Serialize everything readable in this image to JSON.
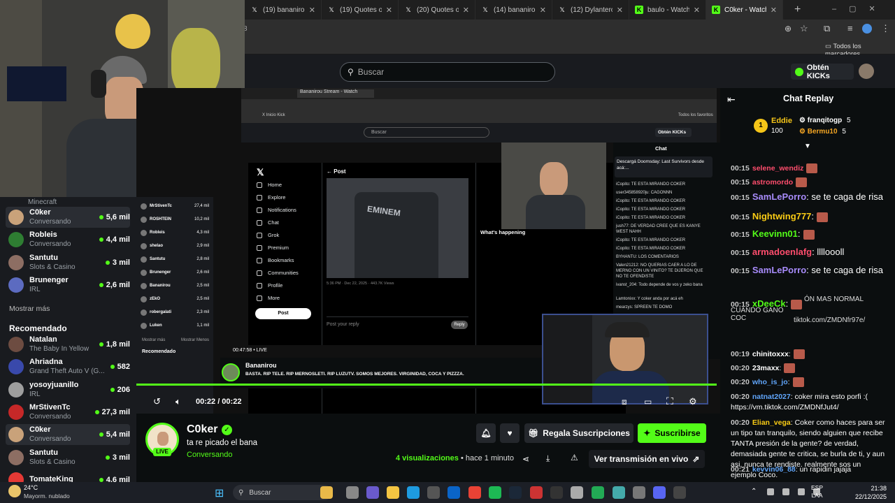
{
  "browser": {
    "tabs": [
      {
        "label": "(19) bananirou o",
        "icon": "x-logo-icon"
      },
      {
        "label": "(19) Quotes of th",
        "icon": "x-logo-icon"
      },
      {
        "label": "(20) Quotes of th",
        "icon": "x-logo-icon"
      },
      {
        "label": "(14) bananirou o",
        "icon": "x-logo-icon"
      },
      {
        "label": "(12) Dylantero o",
        "icon": "x-logo-icon"
      },
      {
        "label": "baulo - Watch cli",
        "icon": "kick-logo-icon"
      },
      {
        "label": "C0ker - Watch cli",
        "icon": "kick-logo-icon",
        "active": true
      }
    ],
    "address_fragment": "8",
    "bookmarks_label": "Todos los marcadores"
  },
  "header": {
    "search_placeholder": "Buscar",
    "get_kicks_label": "Obtén KICKs"
  },
  "sidebar": {
    "top_category": "Minecraft",
    "following": [
      {
        "name": "C0ker",
        "category": "Conversando",
        "viewers": "5,6 mil",
        "color": "#c9a27a",
        "selected": true
      },
      {
        "name": "Robleis",
        "category": "Conversando",
        "viewers": "4,4 mil",
        "color": "#2e7d32"
      },
      {
        "name": "Santutu",
        "category": "Slots & Casino",
        "viewers": "3 mil",
        "color": "#8d6e63"
      },
      {
        "name": "Brunenger",
        "category": "IRL",
        "viewers": "2,6 mil",
        "color": "#5c6bc0"
      }
    ],
    "show_more": "Mostrar más",
    "recommended_title": "Recomendado",
    "recommended": [
      {
        "name": "Natalan",
        "category": "The Baby In Yellow",
        "viewers": "1,8 mil",
        "color": "#6d4c41"
      },
      {
        "name": "Ahriadna",
        "category": "Grand Theft Auto V (G...",
        "viewers": "582",
        "color": "#3949ab"
      },
      {
        "name": "yosoyjuanillo",
        "category": "IRL",
        "viewers": "206",
        "color": "#9e9e9e"
      },
      {
        "name": "MrStivenTc",
        "category": "Conversando",
        "viewers": "27,3 mil",
        "color": "#c62828"
      },
      {
        "name": "C0ker",
        "category": "Conversando",
        "viewers": "5,4 mil",
        "color": "#c9a27a",
        "selected": true
      },
      {
        "name": "Santutu",
        "category": "Slots & Casino",
        "viewers": "3 mil",
        "color": "#8d6e63"
      },
      {
        "name": "TomateKing",
        "category": "",
        "viewers": "4,6 mil",
        "color": "#e53935"
      }
    ]
  },
  "player": {
    "time": "00:22 / 00:22"
  },
  "stream": {
    "channel": "C0ker",
    "title": "ta re picado el bana",
    "category": "Conversando",
    "live_badge": "LIVE",
    "gift_label": "Regala Suscripciones",
    "subscribe_label": "Suscribirse",
    "views": "4 visualizaciones",
    "ago": "• hace 1 minuto",
    "watch_live_label": "Ver transmisión en vivo"
  },
  "inner_stream": {
    "channel": "Bananirou",
    "title": "BASTA. RIP TELE. RIP MERNOSLETI. RIP LUZUTV. SOMOS MEJORES. VIRGINIDAD, COCA Y PIZZZA.",
    "time": "00:47:58",
    "live": "LIVE",
    "x_nav": [
      "Home",
      "Explore",
      "Notifications",
      "Chat",
      "Grok",
      "Premium",
      "Bookmarks",
      "Communities",
      "Profile",
      "More"
    ],
    "x_post_button": "Post",
    "x_header": "Post",
    "x_reply": "Post your reply",
    "x_reply_btn": "Reply",
    "x_date": "5:36 PM · Dec 22, 2025 · 443.7K Views",
    "x_happening": "What's happening",
    "inner_search": "Buscar",
    "inner_kicks": "Obtén KICKs",
    "inner_chat_title": "Chat",
    "inner_sidebar": [
      {
        "name": "MrStivenTc",
        "viewers": "27,4 mil"
      },
      {
        "name": "ROSHTEIN",
        "viewers": "10,2 mil"
      },
      {
        "name": "Robleis",
        "viewers": "4,3 mil"
      },
      {
        "name": "shelao",
        "viewers": "2,9 mil"
      },
      {
        "name": "Santutu",
        "viewers": "2,8 mil"
      },
      {
        "name": "Brunenger",
        "viewers": "2,6 mil"
      },
      {
        "name": "Bananirou",
        "viewers": "2,5 mil"
      },
      {
        "name": "zEkO",
        "viewers": "2,5 mil"
      },
      {
        "name": "robergalati",
        "viewers": "2,3 mil"
      },
      {
        "name": "Luken",
        "viewers": "1,1 mil"
      }
    ],
    "inner_chat": [
      "iCopito: TE ESTA MIRANDO COKER",
      "user345858920ju: CAGONNN",
      "iCopito: TE ESTA MIRANDO COKER",
      "iCopito: TE ESTA MIRANDO COKER",
      "iCopito: TE ESTA MIRANDO COKER",
      "jush77: DE VERDAD CREE QUE ES KANYE WEST NAHH",
      "iCopito: TE ESTA MIRANDO COKER",
      "iCopito: TE ESTA MIRANDO COKER",
      "BYHANTU: LOS COMENTARIOS",
      "Valen21212: NO QUERIAS CAER A LO DE MERNO CON UN VINITO? TE DIJERON QUE NO TE OFENDISTE",
      "ivanst_204: Todo depende de vos y zeko bana",
      "Lamtonixx: Y coker anda por acá eh",
      "mearzys: SPREEN TE DOMO"
    ]
  },
  "chat": {
    "title": "Chat Replay",
    "leaderboard": [
      {
        "rank": "1",
        "name": "Eddie",
        "value": "100",
        "color": "#f5c518"
      },
      {
        "name": "franqitogp",
        "value": "5",
        "color": "#ffffff"
      },
      {
        "name": "Bermu10",
        "value": "5",
        "color": "#f5a623"
      }
    ],
    "messages": [
      {
        "t": "00:15",
        "user": "selene_wendiz",
        "text": "",
        "color": "#ff4d6d"
      },
      {
        "t": "00:15",
        "user": "astromordo",
        "text": "",
        "color": "#ff4d6d"
      },
      {
        "t": "00:15",
        "user": "SamLePorro",
        "text": ": se te caga de risa",
        "color": "#a78bfa"
      },
      {
        "t": "00:15",
        "user": "Nightwing777",
        "text": ":",
        "color": "#facc15"
      },
      {
        "t": "00:15",
        "user": "Keevinn01",
        "text": ":",
        "color": "#53fc18"
      },
      {
        "t": "00:15",
        "user": "armadoenlafg",
        "text": ": lllloooll",
        "color": "#ff4d6d"
      },
      {
        "t": "00:15",
        "user": "SamLePorro",
        "text": ": se te caga de risa",
        "color": "#a78bfa"
      },
      {
        "t": "00:15",
        "user": "xDeeCk",
        "text": ":",
        "color": "#53fc18"
      },
      {
        "t": "00:19",
        "user": "chinitoxxx",
        "text": ":",
        "color": "#ffffff"
      },
      {
        "t": "00:20",
        "user": "23maxx",
        "text": ":",
        "color": "#ffffff"
      },
      {
        "t": "00:20",
        "user": "who_is_jo",
        "text": ":",
        "color": "#60a5fa"
      },
      {
        "t": "00:20",
        "user": "natnat2027",
        "text": ": coker mira esto porfi :( https://vm.tiktok.com/ZMDNfJut4/",
        "color": "#60a5fa"
      },
      {
        "t": "00:20",
        "user": "Elian_vega",
        "text": ": Coker como haces para ser un tipo tan tranquilo, siendo alguien que recibe TANTA presión de la gente? de verdad, demasiada gente te critica, se burla de ti, y aun asi, nunca te rendiste. realmente sos un ejemplo Coco.",
        "color": "#facc15"
      },
      {
        "t": "00:21",
        "user": "kevvin06_88",
        "text": ": un rapidin jajaja",
        "color": "#60a5fa"
      }
    ],
    "overlay_text": "CUANDO GANO COC",
    "overlay_link": "tiktok.com/ZMDNfr97e/",
    "overlay_text2": "ÓN MAS NORMAL"
  },
  "taskbar": {
    "weather_temp": "24°C",
    "weather_desc": "Mayorm. nublado",
    "search_placeholder": "Buscar",
    "lang_top": "ESP",
    "lang_bottom": "LAA",
    "time": "21:38",
    "date": "22/12/2025"
  },
  "colors": {
    "kick_green": "#53fc18",
    "bg": "#0b0e0f",
    "panel": "#191b1f"
  }
}
